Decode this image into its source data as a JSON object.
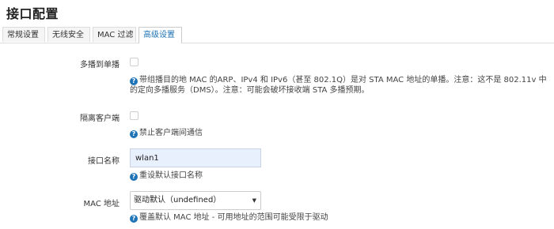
{
  "page": {
    "title": "接口配置"
  },
  "tabs": [
    {
      "label": "常规设置",
      "active": false
    },
    {
      "label": "无线安全",
      "active": false
    },
    {
      "label": "MAC 过滤",
      "active": false
    },
    {
      "label": "高级设置",
      "active": true
    }
  ],
  "fields": {
    "multicast_to_unicast": {
      "label": "多播到单播",
      "checked": false,
      "help_line1": "带组播目的地 MAC 的ARP、IPv4 和 IPv6（甚至 802.1Q）是对 STA MAC 地址的单播。注意：这不是 802.11v 中",
      "help_line2": "的定向多播服务（DMS）。注意：可能会破坏接收端 STA 多播预期。"
    },
    "isolate_clients": {
      "label": "隔离客户端",
      "checked": false,
      "help": "禁止客户端间通信"
    },
    "interface_name": {
      "label": "接口名称",
      "value": "wlan1",
      "help": "重设默认接口名称"
    },
    "mac_address": {
      "label": "MAC 地址",
      "selected": "驱动默认（undefined）",
      "help": "覆盖默认 MAC 地址 - 可用地址的范围可能受限于驱动"
    }
  },
  "icons": {
    "help": "help-circle-icon",
    "dropdown": "caret-down-icon"
  },
  "colors": {
    "accent": "#1f74b7",
    "input_autofill_bg": "#e8f0fe"
  }
}
